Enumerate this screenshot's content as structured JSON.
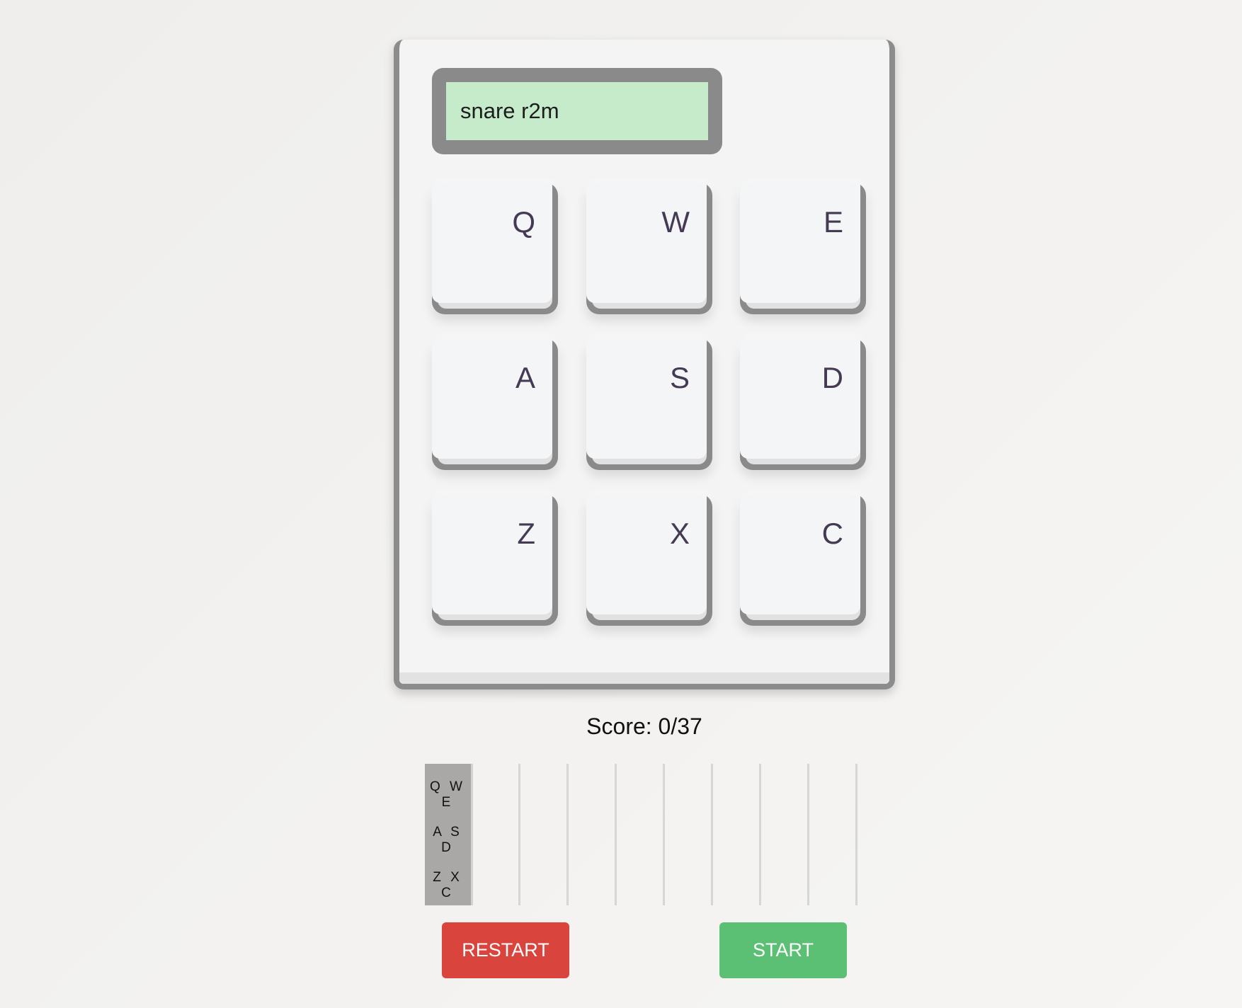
{
  "display": {
    "text": "snare r2m",
    "bg_color": "#c5ebcb"
  },
  "keys": [
    {
      "label": "Q"
    },
    {
      "label": "W"
    },
    {
      "label": "E"
    },
    {
      "label": "A"
    },
    {
      "label": "S"
    },
    {
      "label": "D"
    },
    {
      "label": "Z"
    },
    {
      "label": "X"
    },
    {
      "label": "C"
    }
  ],
  "score": {
    "text": "Score: 0/37"
  },
  "sequencer": {
    "key_map_rows": [
      "QWE",
      "ASD",
      "ZXC"
    ],
    "step_columns": 8
  },
  "buttons": {
    "restart_label": "RESTART",
    "start_label": "START",
    "restart_color": "#d9443d",
    "start_color": "#5bbf74"
  }
}
